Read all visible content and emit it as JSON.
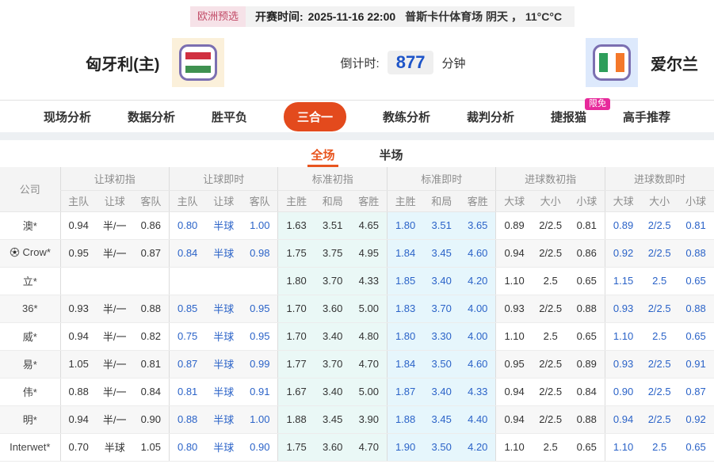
{
  "top_bar": {
    "league_badge": "欧洲预选",
    "kickoff_label": "开赛时间:",
    "kickoff_time": "2025-11-16 22:00",
    "venue_weather": "普斯卡什体育场  阴天 ， 11°C°C"
  },
  "match": {
    "home_name": "匈牙利(主)",
    "away_name": "爱尔兰",
    "home_flag": "hungary-flag",
    "away_flag": "ireland-flag",
    "countdown_label": "倒计时:",
    "countdown_value": "877",
    "countdown_unit": "分钟"
  },
  "nav": {
    "items": [
      {
        "label": "现场分析",
        "active": false
      },
      {
        "label": "数据分析",
        "active": false
      },
      {
        "label": "胜平负",
        "active": false
      },
      {
        "label": "三合一",
        "active": true
      },
      {
        "label": "教练分析",
        "active": false
      },
      {
        "label": "裁判分析",
        "active": false
      },
      {
        "label": "捷报猫",
        "active": false,
        "badge": "限免"
      },
      {
        "label": "高手推荐",
        "active": false
      }
    ]
  },
  "tabs": {
    "items": [
      {
        "label": "全场",
        "active": true
      },
      {
        "label": "半场",
        "active": false
      }
    ]
  },
  "table": {
    "company_header": "公司",
    "groups": [
      {
        "label": "让球初指",
        "cols": [
          "主队",
          "让球",
          "客队"
        ]
      },
      {
        "label": "让球即时",
        "cols": [
          "主队",
          "让球",
          "客队"
        ]
      },
      {
        "label": "标准初指",
        "cols": [
          "主胜",
          "和局",
          "客胜"
        ]
      },
      {
        "label": "标准即时",
        "cols": [
          "主胜",
          "和局",
          "客胜"
        ]
      },
      {
        "label": "进球数初指",
        "cols": [
          "大球",
          "大小",
          "小球"
        ]
      },
      {
        "label": "进球数即时",
        "cols": [
          "大球",
          "大小",
          "小球"
        ]
      }
    ],
    "rows": [
      {
        "company": "澳*",
        "icon": false,
        "cells": [
          "0.94",
          "半/一",
          "0.86",
          "0.80",
          "半球",
          "1.00",
          "1.63",
          "3.51",
          "4.65",
          "1.80",
          "3.51",
          "3.65",
          "0.89",
          "2/2.5",
          "0.81",
          "0.89",
          "2/2.5",
          "0.81"
        ]
      },
      {
        "company": "Crow*",
        "icon": true,
        "cells": [
          "0.95",
          "半/一",
          "0.87",
          "0.84",
          "半球",
          "0.98",
          "1.75",
          "3.75",
          "4.95",
          "1.84",
          "3.45",
          "4.60",
          "0.94",
          "2/2.5",
          "0.86",
          "0.92",
          "2/2.5",
          "0.88"
        ]
      },
      {
        "company": "立*",
        "icon": false,
        "cells": [
          "",
          "",
          "",
          "",
          "",
          "",
          "1.80",
          "3.70",
          "4.33",
          "1.85",
          "3.40",
          "4.20",
          "1.10",
          "2.5",
          "0.65",
          "1.15",
          "2.5",
          "0.65"
        ]
      },
      {
        "company": "36*",
        "icon": false,
        "cells": [
          "0.93",
          "半/一",
          "0.88",
          "0.85",
          "半球",
          "0.95",
          "1.70",
          "3.60",
          "5.00",
          "1.83",
          "3.70",
          "4.00",
          "0.93",
          "2/2.5",
          "0.88",
          "0.93",
          "2/2.5",
          "0.88"
        ]
      },
      {
        "company": "威*",
        "icon": false,
        "cells": [
          "0.94",
          "半/一",
          "0.82",
          "0.75",
          "半球",
          "0.95",
          "1.70",
          "3.40",
          "4.80",
          "1.80",
          "3.30",
          "4.00",
          "1.10",
          "2.5",
          "0.65",
          "1.10",
          "2.5",
          "0.65"
        ]
      },
      {
        "company": "易*",
        "icon": false,
        "cells": [
          "1.05",
          "半/一",
          "0.81",
          "0.87",
          "半球",
          "0.99",
          "1.77",
          "3.70",
          "4.70",
          "1.84",
          "3.50",
          "4.60",
          "0.95",
          "2/2.5",
          "0.89",
          "0.93",
          "2/2.5",
          "0.91"
        ]
      },
      {
        "company": "伟*",
        "icon": false,
        "cells": [
          "0.88",
          "半/一",
          "0.84",
          "0.81",
          "半球",
          "0.91",
          "1.67",
          "3.40",
          "5.00",
          "1.87",
          "3.40",
          "4.33",
          "0.94",
          "2/2.5",
          "0.84",
          "0.90",
          "2/2.5",
          "0.87"
        ]
      },
      {
        "company": "明*",
        "icon": false,
        "cells": [
          "0.94",
          "半/一",
          "0.90",
          "0.88",
          "半球",
          "1.00",
          "1.88",
          "3.45",
          "3.90",
          "1.88",
          "3.45",
          "4.40",
          "0.94",
          "2/2.5",
          "0.88",
          "0.94",
          "2/2.5",
          "0.92"
        ]
      },
      {
        "company": "Interwet*",
        "icon": false,
        "cells": [
          "0.70",
          "半球",
          "1.05",
          "0.80",
          "半球",
          "0.90",
          "1.75",
          "3.60",
          "4.70",
          "1.90",
          "3.50",
          "4.20",
          "1.10",
          "2.5",
          "0.65",
          "1.10",
          "2.5",
          "0.65"
        ]
      }
    ]
  },
  "colors": {
    "accent_orange": "#e34a1d",
    "tab_orange": "#e8551f",
    "live_blue": "#2b63c8",
    "countdown_blue": "#1d54c8",
    "badge_magenta": "#e72a9b",
    "league_badge_bg": "#f6e2e8",
    "league_badge_text": "#c14a66",
    "std_initial_bg": "#eaf8f6",
    "std_live_bg": "#e6f6fc"
  }
}
